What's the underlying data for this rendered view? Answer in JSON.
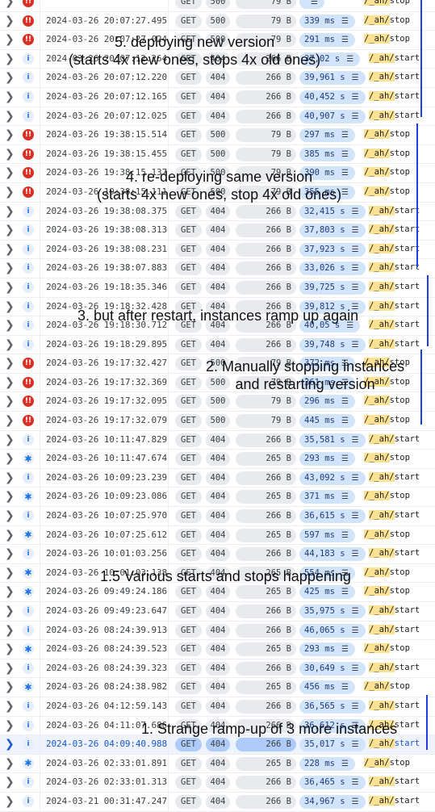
{
  "rows": [
    {
      "sev": "error",
      "icon": "!!",
      "ts": "",
      "method": "GET",
      "status": "500",
      "size": "79 B",
      "latency": "",
      "path_hl": "/_ah/",
      "path_rest": "stop",
      "partial": true
    },
    {
      "sev": "error",
      "icon": "!!",
      "ts": "2024-03-26 20:07:27.495",
      "method": "GET",
      "status": "500",
      "size": "79 B",
      "latency": "339 ms",
      "path_hl": "/_ah/",
      "path_rest": "stop"
    },
    {
      "sev": "error",
      "icon": "!!",
      "ts": "2024-03-26 20:07:27.024",
      "method": "GET",
      "status": "500",
      "size": "79 B",
      "latency": "291 ms",
      "path_hl": "/_ah/",
      "path_rest": "stop"
    },
    {
      "sev": "info",
      "icon": "i",
      "ts": "2024-03-26 20:07:12.264",
      "method": "GET",
      "status": "404",
      "size": "266 B",
      "latency": "37,02 s",
      "path_hl": "/_ah/",
      "path_rest": "start"
    },
    {
      "sev": "info",
      "icon": "i",
      "ts": "2024-03-26 20:07:12.220",
      "method": "GET",
      "status": "404",
      "size": "266 B",
      "latency": "39,961 s",
      "path_hl": "/_ah/",
      "path_rest": "start"
    },
    {
      "sev": "info",
      "icon": "i",
      "ts": "2024-03-26 20:07:12.165",
      "method": "GET",
      "status": "404",
      "size": "266 B",
      "latency": "40,452 s",
      "path_hl": "/_ah/",
      "path_rest": "start"
    },
    {
      "sev": "info",
      "icon": "i",
      "ts": "2024-03-26 20:07:12.025",
      "method": "GET",
      "status": "404",
      "size": "266 B",
      "latency": "40,907 s",
      "path_hl": "/_ah/",
      "path_rest": "start"
    },
    {
      "sev": "error",
      "icon": "!!",
      "ts": "2024-03-26 19:38:15.514",
      "method": "GET",
      "status": "500",
      "size": "79 B",
      "latency": "297 ms",
      "path_hl": "/_ah/",
      "path_rest": "stop"
    },
    {
      "sev": "error",
      "icon": "!!",
      "ts": "2024-03-26 19:38:15.455",
      "method": "GET",
      "status": "500",
      "size": "79 B",
      "latency": "385 ms",
      "path_hl": "/_ah/",
      "path_rest": "stop"
    },
    {
      "sev": "error",
      "icon": "!!",
      "ts": "2024-03-26 19:38:15.137",
      "method": "GET",
      "status": "500",
      "size": "79 B",
      "latency": "390 ms",
      "path_hl": "/_ah/",
      "path_rest": "stop"
    },
    {
      "sev": "error",
      "icon": "!!",
      "ts": "2024-03-26 19:38:15.111",
      "method": "GET",
      "status": "500",
      "size": "79 B",
      "latency": "355 ms",
      "path_hl": "/_ah/",
      "path_rest": "stop"
    },
    {
      "sev": "info",
      "icon": "i",
      "ts": "2024-03-26 19:38:08.375",
      "method": "GET",
      "status": "404",
      "size": "266 B",
      "latency": "32,415 s",
      "path_hl": "/_ah/",
      "path_rest": "start"
    },
    {
      "sev": "info",
      "icon": "i",
      "ts": "2024-03-26 19:38:08.313",
      "method": "GET",
      "status": "404",
      "size": "266 B",
      "latency": "37,803 s",
      "path_hl": "/_ah/",
      "path_rest": "start"
    },
    {
      "sev": "info",
      "icon": "i",
      "ts": "2024-03-26 19:38:08.231",
      "method": "GET",
      "status": "404",
      "size": "266 B",
      "latency": "37,923 s",
      "path_hl": "/_ah/",
      "path_rest": "start"
    },
    {
      "sev": "info",
      "icon": "i",
      "ts": "2024-03-26 19:38:07.883",
      "method": "GET",
      "status": "404",
      "size": "266 B",
      "latency": "33,026 s",
      "path_hl": "/_ah/",
      "path_rest": "start"
    },
    {
      "sev": "info",
      "icon": "i",
      "ts": "2024-03-26 19:18:35.346",
      "method": "GET",
      "status": "404",
      "size": "266 B",
      "latency": "39,725 s",
      "path_hl": "/_ah/",
      "path_rest": "start"
    },
    {
      "sev": "info",
      "icon": "i",
      "ts": "2024-03-26 19:18:32.428",
      "method": "GET",
      "status": "404",
      "size": "266 B",
      "latency": "39,812 s",
      "path_hl": "/_ah/",
      "path_rest": "start"
    },
    {
      "sev": "info",
      "icon": "i",
      "ts": "2024-03-26 19:18:30.712",
      "method": "GET",
      "status": "404",
      "size": "266 B",
      "latency": "40,05 s",
      "path_hl": "/_ah/",
      "path_rest": "start"
    },
    {
      "sev": "info",
      "icon": "i",
      "ts": "2024-03-26 19:18:29.895",
      "method": "GET",
      "status": "404",
      "size": "266 B",
      "latency": "39,748 s",
      "path_hl": "/_ah/",
      "path_rest": "start"
    },
    {
      "sev": "error",
      "icon": "!!",
      "ts": "2024-03-26 19:17:32.427",
      "method": "GET",
      "status": "500",
      "size": "79 B",
      "latency": "372 ms",
      "path_hl": "/_ah/",
      "path_rest": "stop"
    },
    {
      "sev": "error",
      "icon": "!!",
      "ts": "2024-03-26 19:17:32.369",
      "method": "GET",
      "status": "500",
      "size": "79 B",
      "latency": "361 ms",
      "path_hl": "/_ah/",
      "path_rest": "stop"
    },
    {
      "sev": "error",
      "icon": "!!",
      "ts": "2024-03-26 19:17:32.095",
      "method": "GET",
      "status": "500",
      "size": "79 B",
      "latency": "296 ms",
      "path_hl": "/_ah/",
      "path_rest": "stop"
    },
    {
      "sev": "error",
      "icon": "!!",
      "ts": "2024-03-26 19:17:32.079",
      "method": "GET",
      "status": "500",
      "size": "79 B",
      "latency": "445 ms",
      "path_hl": "/_ah/",
      "path_rest": "stop"
    },
    {
      "sev": "info",
      "icon": "i",
      "ts": "2024-03-26 10:11:47.829",
      "method": "GET",
      "status": "404",
      "size": "266 B",
      "latency": "35,581 s",
      "path_hl": "/_ah/",
      "path_rest": "start"
    },
    {
      "sev": "debug",
      "icon": "✱",
      "ts": "2024-03-26 10:11:47.674",
      "method": "GET",
      "status": "404",
      "size": "265 B",
      "latency": "293 ms",
      "path_hl": "/_ah/",
      "path_rest": "stop"
    },
    {
      "sev": "info",
      "icon": "i",
      "ts": "2024-03-26 10:09:23.239",
      "method": "GET",
      "status": "404",
      "size": "266 B",
      "latency": "43,092 s",
      "path_hl": "/_ah/",
      "path_rest": "start"
    },
    {
      "sev": "debug",
      "icon": "✱",
      "ts": "2024-03-26 10:09:23.086",
      "method": "GET",
      "status": "404",
      "size": "265 B",
      "latency": "371 ms",
      "path_hl": "/_ah/",
      "path_rest": "stop"
    },
    {
      "sev": "info",
      "icon": "i",
      "ts": "2024-03-26 10:07:25.970",
      "method": "GET",
      "status": "404",
      "size": "266 B",
      "latency": "36,615 s",
      "path_hl": "/_ah/",
      "path_rest": "start"
    },
    {
      "sev": "debug",
      "icon": "✱",
      "ts": "2024-03-26 10:07:25.612",
      "method": "GET",
      "status": "404",
      "size": "265 B",
      "latency": "597 ms",
      "path_hl": "/_ah/",
      "path_rest": "stop"
    },
    {
      "sev": "info",
      "icon": "i",
      "ts": "2024-03-26 10:01:03.256",
      "method": "GET",
      "status": "404",
      "size": "266 B",
      "latency": "44,183 s",
      "path_hl": "/_ah/",
      "path_rest": "start"
    },
    {
      "sev": "debug",
      "icon": "✱",
      "ts": "2024-03-26 10:01:03.138",
      "method": "GET",
      "status": "404",
      "size": "265 B",
      "latency": "554 ms",
      "path_hl": "/_ah/",
      "path_rest": "stop"
    },
    {
      "sev": "debug",
      "icon": "✱",
      "ts": "2024-03-26 09:49:24.186",
      "method": "GET",
      "status": "404",
      "size": "265 B",
      "latency": "425 ms",
      "path_hl": "/_ah/",
      "path_rest": "stop"
    },
    {
      "sev": "info",
      "icon": "i",
      "ts": "2024-03-26 09:49:23.647",
      "method": "GET",
      "status": "404",
      "size": "266 B",
      "latency": "35,975 s",
      "path_hl": "/_ah/",
      "path_rest": "start"
    },
    {
      "sev": "info",
      "icon": "i",
      "ts": "2024-03-26 08:24:39.913",
      "method": "GET",
      "status": "404",
      "size": "266 B",
      "latency": "46,065 s",
      "path_hl": "/_ah/",
      "path_rest": "start"
    },
    {
      "sev": "debug",
      "icon": "✱",
      "ts": "2024-03-26 08:24:39.523",
      "method": "GET",
      "status": "404",
      "size": "265 B",
      "latency": "293 ms",
      "path_hl": "/_ah/",
      "path_rest": "stop"
    },
    {
      "sev": "info",
      "icon": "i",
      "ts": "2024-03-26 08:24:39.323",
      "method": "GET",
      "status": "404",
      "size": "266 B",
      "latency": "30,649 s",
      "path_hl": "/_ah/",
      "path_rest": "start"
    },
    {
      "sev": "debug",
      "icon": "✱",
      "ts": "2024-03-26 08:24:38.982",
      "method": "GET",
      "status": "404",
      "size": "265 B",
      "latency": "456 ms",
      "path_hl": "/_ah/",
      "path_rest": "stop"
    },
    {
      "sev": "info",
      "icon": "i",
      "ts": "2024-03-26 04:12:59.143",
      "method": "GET",
      "status": "404",
      "size": "266 B",
      "latency": "36,565 s",
      "path_hl": "/_ah/",
      "path_rest": "start"
    },
    {
      "sev": "info",
      "icon": "i",
      "ts": "2024-03-26 04:11:07.686",
      "method": "GET",
      "status": "404",
      "size": "266 B",
      "latency": "36,612 s",
      "path_hl": "/_ah/",
      "path_rest": "start"
    },
    {
      "sev": "info",
      "icon": "i",
      "ts": "2024-03-26 04:09:40.988",
      "method": "GET",
      "status": "404",
      "size": "266 B",
      "latency": "35,017 s",
      "path_hl": "/_ah/",
      "path_rest": "start",
      "selected": true
    },
    {
      "sev": "debug",
      "icon": "✱",
      "ts": "2024-03-26 02:33:01.891",
      "method": "GET",
      "status": "404",
      "size": "265 B",
      "latency": "228 ms",
      "path_hl": "/_ah/",
      "path_rest": "stop"
    },
    {
      "sev": "info",
      "icon": "i",
      "ts": "2024-03-26 02:33:01.313",
      "method": "GET",
      "status": "404",
      "size": "266 B",
      "latency": "36,465 s",
      "path_hl": "/_ah/",
      "path_rest": "start"
    },
    {
      "sev": "info",
      "icon": "i",
      "ts": "2024-03-21 00:31:47.247",
      "method": "GET",
      "status": "404",
      "size": "266 B",
      "latency": "34,967 s",
      "path_hl": "/_ah/",
      "path_rest": "start"
    }
  ],
  "annotations": {
    "a5_line1": "5. deploying new version",
    "a5_line2": "(starts 4x new ones, stops 4x old ones)",
    "a4_line1": "4. re-deploying same version",
    "a4_line2": "(starts 4x new ones, stop 4x old ones)",
    "a3": "3. but after restart, instances ramp up again",
    "a2_line1": "2. Manually stopping instances",
    "a2_line2": "and restarting version",
    "a15": "1.5 Various starts and stops happening",
    "a1": "1. Strange ramp-up of 3 more instances"
  },
  "icons": {
    "expand": "chevron-right",
    "waterfall": "waterfall-icon"
  },
  "colors": {
    "error": "#d93025",
    "info": "#1a73e8",
    "latency_chip": "#d2e3fc",
    "path_highlight": "#fde293",
    "annotation_bar": "#1f3de0"
  }
}
